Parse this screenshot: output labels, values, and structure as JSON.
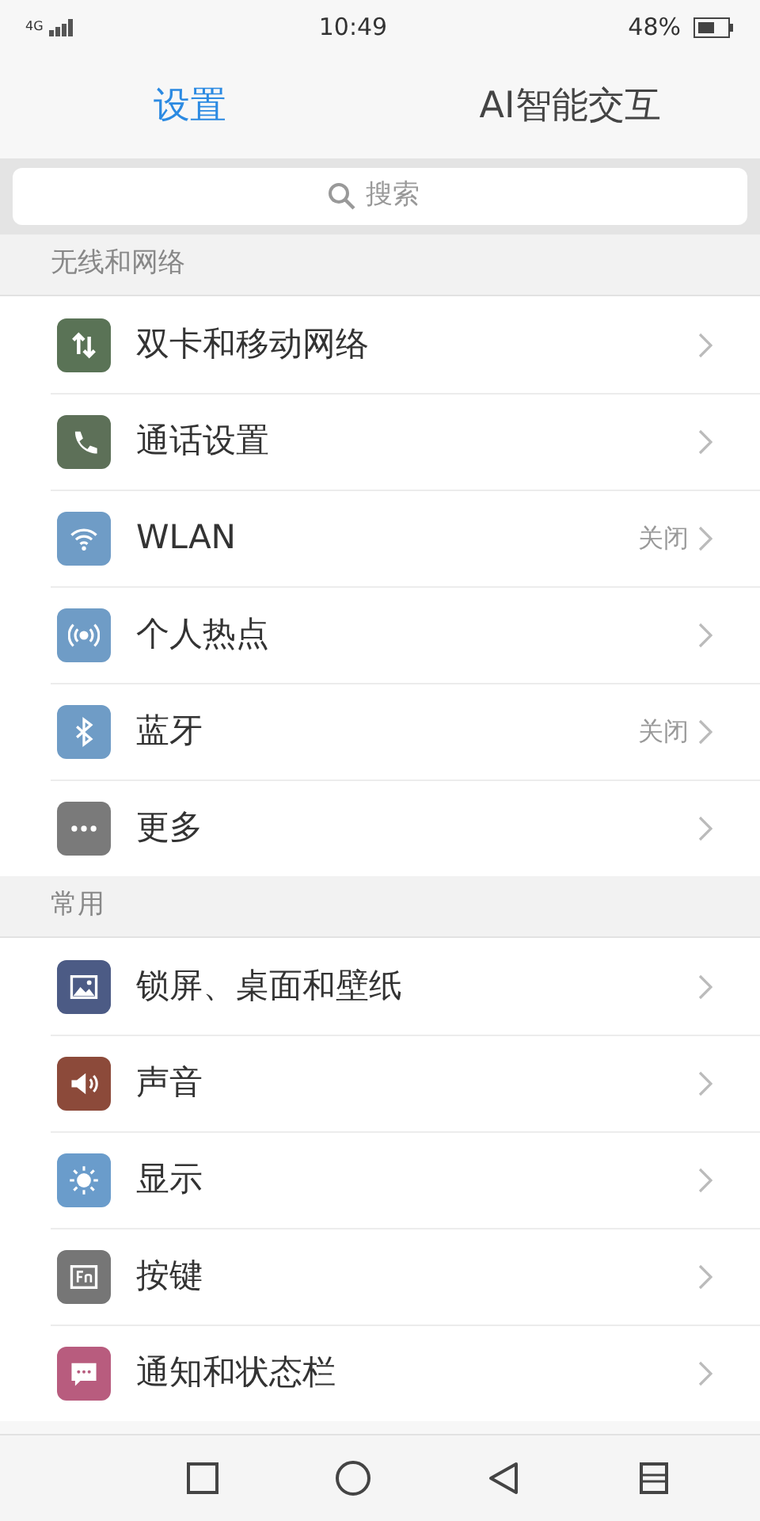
{
  "status_bar": {
    "network": "4G",
    "time": "10:49",
    "battery": "48%"
  },
  "tabs": [
    {
      "label": "设置",
      "selected": true
    },
    {
      "label": "AI智能交互",
      "selected": false
    }
  ],
  "search": {
    "placeholder": "搜索"
  },
  "sections": [
    {
      "title": "无线和网络",
      "items": [
        {
          "label": "双卡和移动网络",
          "kind": "mobile-data",
          "color": "#5a7356"
        },
        {
          "label": "通话设置",
          "kind": "phone",
          "color": "#5d7058"
        },
        {
          "label": "WLAN",
          "kind": "wifi",
          "color": "#6f9cc6",
          "value": "关闭"
        },
        {
          "label": "个人热点",
          "kind": "hotspot",
          "color": "#6f9cc6"
        },
        {
          "label": "蓝牙",
          "kind": "bluetooth",
          "color": "#6f9cc6",
          "value": "关闭"
        },
        {
          "label": "更多",
          "kind": "more",
          "color": "#7a7a7a"
        }
      ]
    },
    {
      "title": "常用",
      "items": [
        {
          "label": "锁屏、桌面和壁纸",
          "kind": "wallpaper",
          "color": "#4c5b85"
        },
        {
          "label": "声音",
          "kind": "sound",
          "color": "#8c4a3a"
        },
        {
          "label": "显示",
          "kind": "display",
          "color": "#6a9ccb"
        },
        {
          "label": "按键",
          "kind": "keys",
          "color": "#767676"
        },
        {
          "label": "通知和状态栏",
          "kind": "notification",
          "color": "#b85c7e"
        }
      ]
    }
  ],
  "nav_bar": [
    {
      "kind": "recents"
    },
    {
      "kind": "home"
    },
    {
      "kind": "back"
    },
    {
      "kind": "menu"
    }
  ]
}
